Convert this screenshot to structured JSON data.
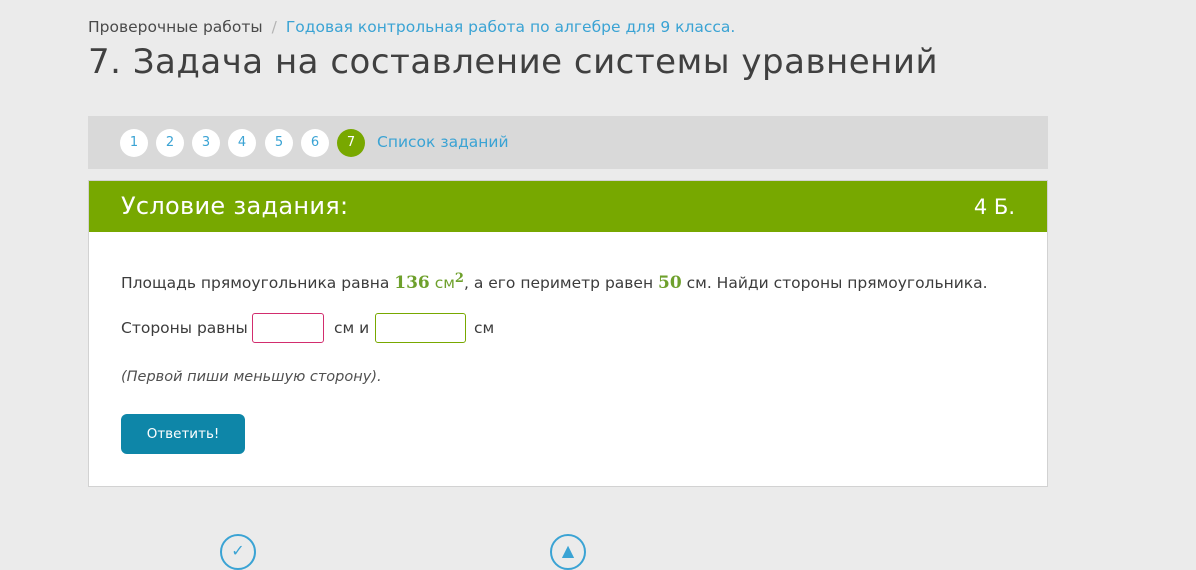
{
  "breadcrumb": {
    "root": "Проверочные работы",
    "separator": "/",
    "current": "Годовая контрольная работа по алгебре для 9 класса."
  },
  "page_title": "7. Задача на составление системы уравнений",
  "nav": {
    "items": [
      "1",
      "2",
      "3",
      "4",
      "5",
      "6",
      "7"
    ],
    "active": "7",
    "list_link": "Список заданий"
  },
  "task": {
    "header_title": "Условие задания:",
    "points": "4 Б.",
    "text_before_area": "Площадь прямоугольника равна ",
    "area_value": "136",
    "area_unit": "см",
    "area_power": "2",
    "text_before_perimeter": ", а его периметр равен ",
    "perimeter_value": "50",
    "text_after_perimeter": " см. Найди стороны прямоугольника.",
    "answer_label": "Стороны равны",
    "between_label": "см и",
    "after_label": "см",
    "input1_value": "",
    "input2_value": "",
    "hint": "(Первой пиши меньшую сторону).",
    "submit_label": "Ответить!"
  },
  "colors": {
    "accent_green": "#77a800",
    "link_blue": "#3aa3d4",
    "button_teal": "#0e86a8",
    "input_error": "#d22d6e"
  },
  "bottom_icons": [
    "back-icon",
    "up-icon"
  ]
}
